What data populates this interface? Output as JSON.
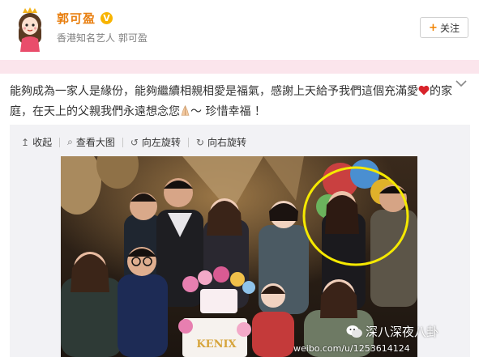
{
  "profile": {
    "name": "郭可盈",
    "verified_mark": "V",
    "description": "香港知名艺人 郭可盈",
    "follow_label": "关注",
    "follow_plus": "+"
  },
  "post": {
    "text_before_heart": "能夠成為一家人是緣份，能夠繼續相親相愛是福氣，感謝上天給予我們這個充滿愛",
    "text_after_heart": "的家庭，在天上的父親我們永遠想念您",
    "text_end": "～ 珍惜幸福 ！"
  },
  "toolbar": {
    "collapse_label": "收起",
    "view_large_label": "查看大图",
    "rotate_left_label": "向左旋转",
    "rotate_right_label": "向右旋转"
  },
  "photo": {
    "watermark_text": "深八深夜八卦",
    "url_text": "weibo.com/u/1253614124",
    "cake_text": "KENIX",
    "highlight_color": "#f5e900"
  },
  "colors": {
    "name": "#e87f10",
    "band": "#fbe5ec",
    "verified": "#f8b400"
  }
}
